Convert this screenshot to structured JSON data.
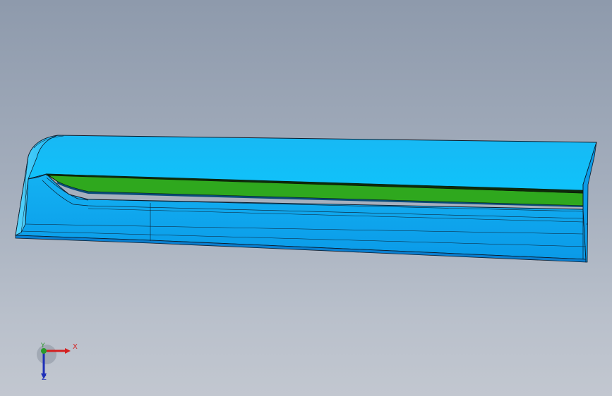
{
  "viewport": {
    "background_top": "#8e9aac",
    "background_bottom": "#c2c7d0"
  },
  "model": {
    "body_color": "#12bff6",
    "side_face_color": "#0a8fe0",
    "insert_color": "#2fa81e",
    "edge_color": "#0d1c2c"
  },
  "triad": {
    "x_label": "X",
    "y_label": "Y",
    "z_label": "Z",
    "x_color": "#d42020",
    "y_color": "#2a9a2a",
    "z_color": "#1e2fb8"
  }
}
